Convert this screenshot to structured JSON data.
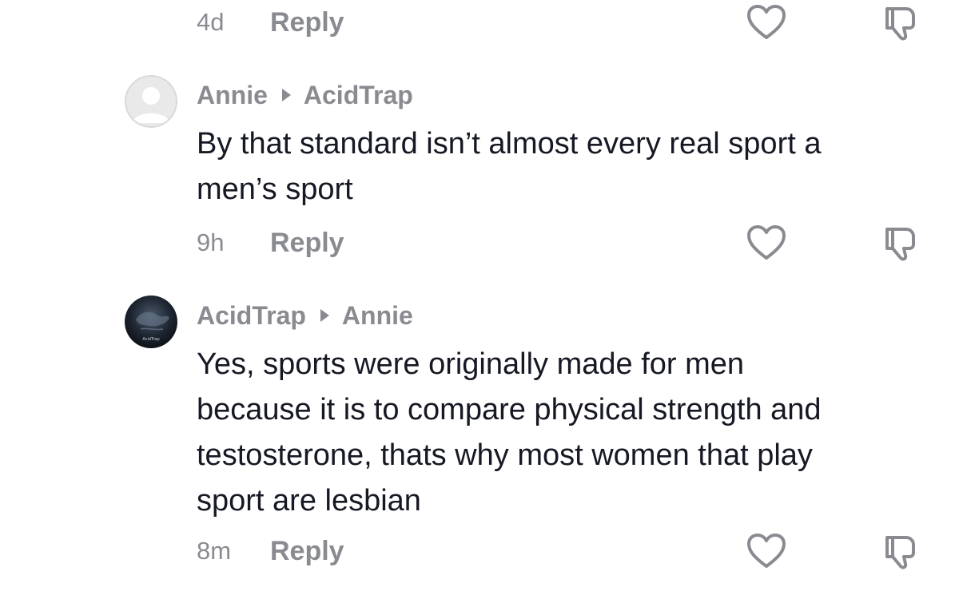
{
  "previous_comment": {
    "time": "4d",
    "reply_label": "Reply"
  },
  "comments": [
    {
      "author": "Annie",
      "reply_to": "AcidTrap",
      "text": "By that standard isn’t almost every real sport a\nmen’s sport",
      "time": "9h",
      "reply_label": "Reply",
      "avatar": "default-avatar"
    },
    {
      "author": "AcidTrap",
      "reply_to": "Annie",
      "text": "Yes, sports were originally made for men\nbecause it is to compare physical strength and\ntestosterone, thats why most women that play\nsport are lesbian",
      "time": "8m",
      "reply_label": "Reply",
      "avatar": "dark-globe-avatar",
      "avatar_text": "AcidTrap"
    }
  ],
  "icons": {
    "like": "heart-icon",
    "dislike": "thumbs-down-icon"
  },
  "colors": {
    "text_primary": "#161823",
    "text_secondary": "#8a8b91",
    "background": "#ffffff"
  }
}
